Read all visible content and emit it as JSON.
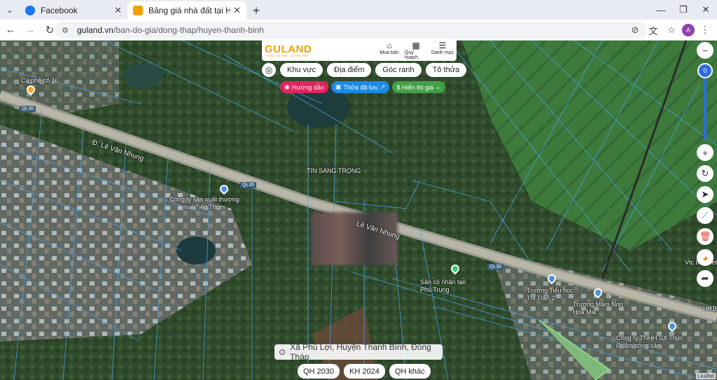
{
  "browser": {
    "tabs": [
      {
        "title": "Facebook",
        "icon": "facebook-icon",
        "icon_color": "#1877f2",
        "active": false
      },
      {
        "title": "Bảng giá nhà đất tại Huyện Tha",
        "icon": "guland-favicon-icon",
        "icon_color": "#f5a000",
        "active": true
      }
    ],
    "new_tab": "+",
    "url_host": "guland.vn",
    "url_path": "/ban-do-gia/dong-thap/huyen-thanh-binh",
    "profile_initial": "A"
  },
  "header": {
    "logo_text": "GULAND",
    "logo_tagline": "THÔNG TIN THẬT - GIÁ TRỊ THẬT",
    "menu": [
      {
        "label": "Mua bán",
        "icon": "house-icon"
      },
      {
        "label": "Quy hoạch",
        "icon": "map-icon"
      },
      {
        "label": "Danh mục",
        "icon": "menu-icon"
      }
    ]
  },
  "filters": {
    "pills": [
      "Khu vực",
      "Địa điểm",
      "Góc ranh",
      "Tô thửa"
    ],
    "guide": "Hướng dẫn",
    "saved": "Thửa đã lưu",
    "price": "$ Hiển thị giá"
  },
  "controls": {
    "zoom_level": "0"
  },
  "map": {
    "road_name_1": "Đ. Lê Văn Nhung",
    "road_name_2": "Lê Văn Nhung",
    "road_code": "QL30",
    "labels": [
      "Cà phê cô 10",
      "Công ty sản xuất thương mại Tiến Thơm",
      "TIN SANG TRỌNG",
      "Sân cỏ nhân tạo Phú Trung",
      "Trường Tiểu học Thị Trấn 2",
      "Trường Mầm Non Hoa Mai",
      "Công ty TNHH SX Thực Phẩm nông sản",
      "Vtc Internet",
      "Ho B"
    ]
  },
  "location": {
    "address": "Xã Phú Lợi, Huyện Thanh Bình, Đồng Tháp"
  },
  "plans": [
    "QH 2030",
    "KH 2024",
    "QH khác"
  ],
  "attribution": "Leaflet"
}
